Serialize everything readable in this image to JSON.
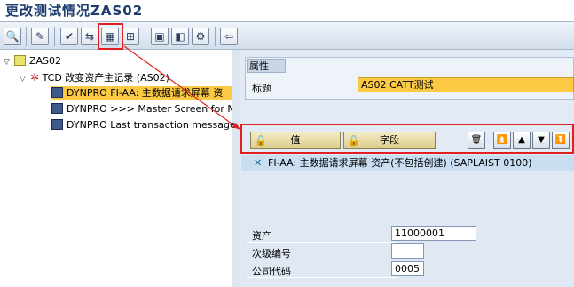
{
  "window": {
    "title": "更改测试情况ZAS02"
  },
  "toolbar": {
    "buttons": [
      {
        "name": "find-icon",
        "glyph": "🔍"
      },
      {
        "name": "edit-icon",
        "glyph": "✎"
      },
      {
        "name": "check-icon",
        "glyph": "✔"
      },
      {
        "name": "copy-icon",
        "glyph": "⇆"
      },
      {
        "name": "field-list-icon",
        "glyph": "▦"
      },
      {
        "name": "structure-icon",
        "glyph": "⊞"
      },
      {
        "name": "insert-icon",
        "glyph": "▣"
      },
      {
        "name": "delete-icon",
        "glyph": "◧"
      },
      {
        "name": "execute-icon",
        "glyph": "⚙"
      },
      {
        "name": "back-icon",
        "glyph": "⇦"
      }
    ]
  },
  "tree": {
    "root": "ZAS02",
    "tcd": "TCD 改变资产主记录 (AS02)",
    "items": [
      "DYNPRO FI-AA: 主数据请求屏幕 资",
      "DYNPRO >>> Master Screen for M",
      "DYNPRO Last transaction message"
    ]
  },
  "attributes": {
    "header": "属性",
    "title_label": "标题",
    "title_value": "AS02 CATT测试"
  },
  "buttons": {
    "value_label": "值",
    "field_label": "字段"
  },
  "screen": {
    "header": "FI-AA: 主数据请求屏幕 资产(不包括创建) (SAPLAIST 0100)",
    "fields": [
      {
        "label": "资产",
        "value": "11000001"
      },
      {
        "label": "次级编号",
        "value": ""
      },
      {
        "label": "公司代码",
        "value": "0005"
      }
    ]
  },
  "colors": {
    "highlight": "#e02020",
    "selected": "#fbc943",
    "title": "#1c3c6e"
  }
}
